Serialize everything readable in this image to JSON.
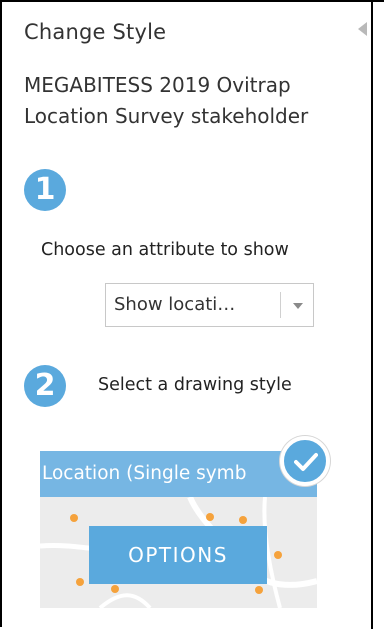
{
  "panel": {
    "title": "Change Style",
    "layer_name": "MEGABITESS 2019 Ovitrap Location Survey stakeholder"
  },
  "step1": {
    "number": "1",
    "label": "Choose an attribute to show",
    "attribute_select": {
      "selected_value": "Show locati…"
    }
  },
  "step2": {
    "number": "2",
    "label": "Select a drawing style",
    "style_card": {
      "name": "Location (Single symb",
      "selected": true,
      "options_label": "OPTIONS"
    }
  },
  "icons": {
    "collapse": "caret-left-icon",
    "dropdown": "chevron-down-icon",
    "selected": "check-icon"
  },
  "colors": {
    "accent": "#5aa9dd",
    "card_header": "#76b6e3",
    "map_point": "#f5a23c"
  }
}
